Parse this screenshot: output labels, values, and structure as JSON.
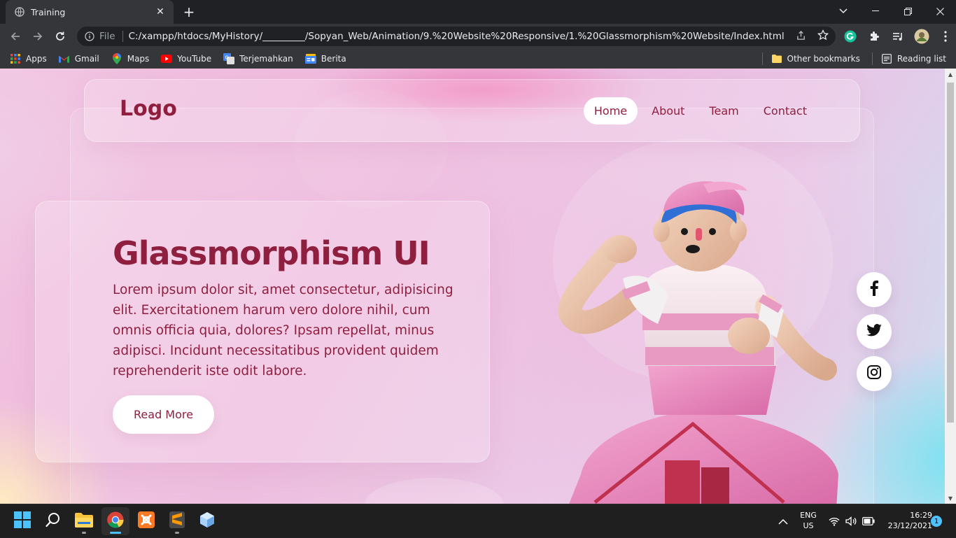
{
  "browser": {
    "tab_title": "Training",
    "omnibox_file_label": "File",
    "url": "C:/xampp/htdocs/MyHistory/_________/Sopyan_Web/Animation/9.%20Website%20Responsive/1.%20Glassmorphism%20Website/Index.html",
    "bookmarks": [
      {
        "label": "Apps",
        "icon": "apps-grid-icon"
      },
      {
        "label": "Gmail",
        "icon": "gmail-icon"
      },
      {
        "label": "Maps",
        "icon": "maps-icon"
      },
      {
        "label": "YouTube",
        "icon": "youtube-icon"
      },
      {
        "label": "Terjemahkan",
        "icon": "translate-icon"
      },
      {
        "label": "Berita",
        "icon": "news-icon"
      }
    ],
    "other_bookmarks": "Other bookmarks",
    "reading_list": "Reading list"
  },
  "page": {
    "logo": "Logo",
    "nav": [
      "Home",
      "About",
      "Team",
      "Contact"
    ],
    "active_nav": "Home",
    "hero_title": "Glassmorphism UI",
    "hero_text": "Lorem ipsum dolor sit, amet consectetur, adipisicing elit. Exercitationem harum vero dolore nihil, cum omnis officia quia, dolores? Ipsam repellat, minus adipisci. Incidunt necessitatibus provident quidem reprehenderit iste odit labore.",
    "read_more": "Read More",
    "social": [
      "facebook-icon",
      "twitter-icon",
      "instagram-icon"
    ],
    "accent_color": "#8f1f3e"
  },
  "taskbar": {
    "lang_line1": "ENG",
    "lang_line2": "US",
    "time": "16:29",
    "date": "23/12/2021",
    "notifications": "1"
  }
}
